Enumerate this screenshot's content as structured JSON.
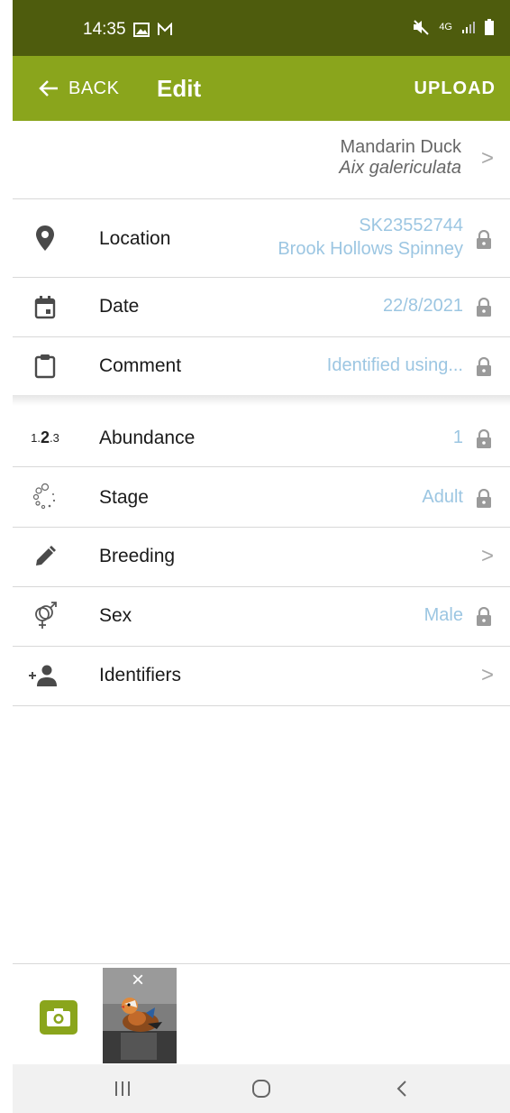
{
  "status": {
    "time": "14:35",
    "network": "4G"
  },
  "appbar": {
    "back_label": "BACK",
    "title": "Edit",
    "upload_label": "UPLOAD"
  },
  "species": {
    "common_name": "Mandarin Duck",
    "scientific_name": "Aix galericulata"
  },
  "rows": {
    "location": {
      "label": "Location",
      "grid_ref": "SK23552744",
      "place": "Brook Hollows Spinney"
    },
    "date": {
      "label": "Date",
      "value": "22/8/2021"
    },
    "comment": {
      "label": "Comment",
      "value": "Identified using..."
    },
    "abundance": {
      "label": "Abundance",
      "value": "1",
      "icon_text": "1.2.3"
    },
    "stage": {
      "label": "Stage",
      "value": "Adult"
    },
    "breeding": {
      "label": "Breeding"
    },
    "sex": {
      "label": "Sex",
      "value": "Male"
    },
    "identifiers": {
      "label": "Identifiers"
    }
  },
  "photos": {
    "remove_label": "×"
  },
  "colors": {
    "status_bar": "#4e5c0d",
    "app_bar": "#8aa51c",
    "value_text": "#9cc6e2",
    "lock_icon": "#9a9a9a"
  },
  "icons": [
    "back-arrow-icon",
    "location-pin-icon",
    "calendar-icon",
    "clipboard-icon",
    "abundance-icon",
    "stage-dots-icon",
    "pencil-icon",
    "gender-icon",
    "add-person-icon",
    "lock-icon",
    "chevron-right-icon",
    "camera-icon"
  ]
}
